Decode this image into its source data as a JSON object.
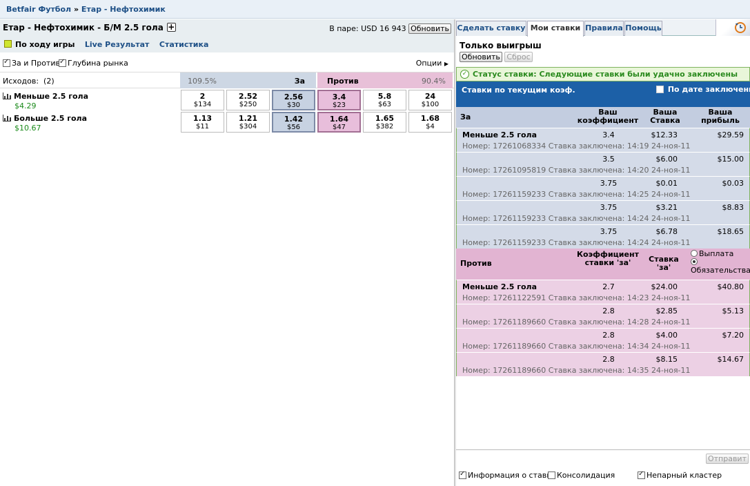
{
  "breadcrumb": {
    "sport": "Betfair Футбол",
    "sep": "»",
    "event": "Етар - Нефтохимик"
  },
  "market": {
    "title": "Етар - Нефтохимик - Б/М 2.5 гола",
    "bank_label": "В паре: USD 16 943",
    "refresh_label": "Обновить",
    "inplay_label": "По ходу игры",
    "live_label": "Live Результат",
    "stats_label": "Статистика",
    "opt_backlay": "За и Против",
    "opt_depth": "Глубина рынка",
    "options_label": "Опции",
    "outcomes_label": "Исходов:",
    "outcomes_count": "(2)",
    "back_pct": "109.5%",
    "back_label": "За",
    "lay_label": "Против",
    "lay_pct": "90.4%",
    "runners": [
      {
        "name": "Меньше 2.5 гола",
        "pl": "$4.29",
        "prices": [
          {
            "p": "2",
            "s": "$134"
          },
          {
            "p": "2.52",
            "s": "$250"
          },
          {
            "p": "2.56",
            "s": "$30"
          },
          {
            "p": "3.4",
            "s": "$23"
          },
          {
            "p": "5.8",
            "s": "$63"
          },
          {
            "p": "24",
            "s": "$100"
          }
        ]
      },
      {
        "name": "Больше 2.5 гола",
        "pl": "$10.67",
        "prices": [
          {
            "p": "1.13",
            "s": "$11"
          },
          {
            "p": "1.21",
            "s": "$304"
          },
          {
            "p": "1.42",
            "s": "$56"
          },
          {
            "p": "1.64",
            "s": "$47"
          },
          {
            "p": "1.65",
            "s": "$382"
          },
          {
            "p": "1.68",
            "s": "$4"
          }
        ]
      }
    ]
  },
  "tabs": [
    "Сделать ставку",
    "Мои ставки",
    "Правила",
    "Помощь"
  ],
  "mybets": {
    "only_win": "Только выигрыш",
    "refresh": "Обновить",
    "reset": "Сброс",
    "status": "Статус ставки: Следующие ставки были удачно заключены",
    "by_odds": "Ставки по текущим коэф.",
    "by_date": "По дате заключения",
    "back_section": {
      "label": "За",
      "col1": "Ваш коэффициент",
      "col2": "Ваша Ставка",
      "col3": "Ваша прибыль",
      "rows": [
        {
          "runner": "Меньше 2.5 гола",
          "odds": "3.4",
          "stake": "$12.33",
          "profit": "$29.59",
          "ref": "Номер: 17261068334 Ставка заключена: 14:19 24-ноя-11"
        },
        {
          "runner": "",
          "odds": "3.5",
          "stake": "$6.00",
          "profit": "$15.00",
          "ref": "Номер: 17261095819 Ставка заключена: 14:20 24-ноя-11"
        },
        {
          "runner": "",
          "odds": "3.75",
          "stake": "$0.01",
          "profit": "$0.03",
          "ref": "Номер: 17261159233 Ставка заключена: 14:25 24-ноя-11"
        },
        {
          "runner": "",
          "odds": "3.75",
          "stake": "$3.21",
          "profit": "$8.83",
          "ref": "Номер: 17261159233 Ставка заключена: 14:24 24-ноя-11"
        },
        {
          "runner": "",
          "odds": "3.75",
          "stake": "$6.78",
          "profit": "$18.65",
          "ref": "Номер: 17261159233 Ставка заключена: 14:24 24-ноя-11"
        }
      ]
    },
    "lay_section": {
      "label": "Против",
      "col1": "Коэффициент ставки 'за'",
      "col2": "Ставка 'за'",
      "radio1": "Выплата",
      "radio2": "Обязательства",
      "rows": [
        {
          "runner": "Меньше 2.5 гола",
          "odds": "2.7",
          "stake": "$24.00",
          "profit": "$40.80",
          "ref": "Номер: 17261122591 Ставка заключена: 14:23 24-ноя-11"
        },
        {
          "runner": "",
          "odds": "2.8",
          "stake": "$2.85",
          "profit": "$5.13",
          "ref": "Номер: 17261189660 Ставка заключена: 14:28 24-ноя-11"
        },
        {
          "runner": "",
          "odds": "2.8",
          "stake": "$4.00",
          "profit": "$7.20",
          "ref": "Номер: 17261189660 Ставка заключена: 14:34 24-ноя-11"
        },
        {
          "runner": "",
          "odds": "2.8",
          "stake": "$8.15",
          "profit": "$14.67",
          "ref": "Номер: 17261189660 Ставка заключена: 14:35 24-ноя-11"
        }
      ]
    },
    "send": "Отправит",
    "foot_info": "Информация о ставке",
    "foot_consol": "Консолидация",
    "foot_cluster": "Непарный кластер"
  },
  "colors": {
    "back_row": "#d4dbe8",
    "lay_row": "#ecd0e4",
    "back_head": "#c3cde0",
    "lay_head": "#e2b4d2",
    "blue_bar": "#1c60a7",
    "status_green": "#2a8a1e",
    "link_blue": "#1d4f86"
  }
}
